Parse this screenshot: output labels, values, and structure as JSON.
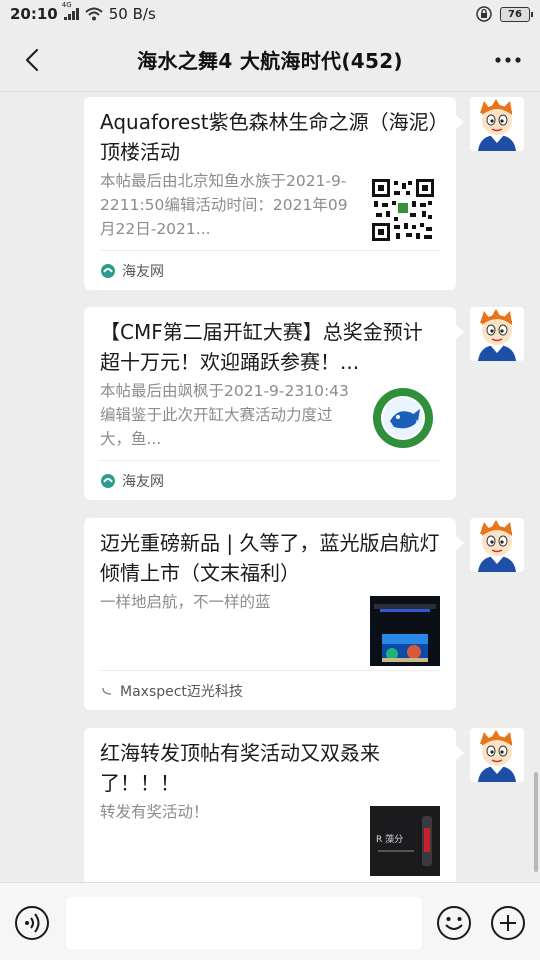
{
  "status_bar": {
    "time": "20:10",
    "network_tag": "4G",
    "speed": "50 B/s",
    "battery": "76"
  },
  "header": {
    "title": "海水之舞4 大航海时代(452)"
  },
  "messages": [
    {
      "title": "Aquaforest紫色森林生命之源（海泥）顶楼活动",
      "desc": "本帖最后由北京知鱼水族于2021-9-2211:50编辑活动时间：2021年09月22日-2021...",
      "source": "海友网",
      "thumb": "qr-code"
    },
    {
      "title": "【CMF第二届开缸大赛】总奖金预计超十万元！欢迎踊跃参赛！...",
      "desc": "本帖最后由飒枫于2021-9-2310:43编辑鉴于此次开缸大赛活动力度过大，鱼...",
      "source": "海友网",
      "thumb": "badge-logo"
    },
    {
      "title": "迈光重磅新品 | 久等了，蓝光版启航灯倾情上市（文末福利）",
      "desc": "一样地启航，不一样的蓝",
      "source": "Maxspect迈光科技",
      "thumb": "aquarium-photo"
    },
    {
      "title": "红海转发顶帖有奖活动又双叒来了！！！",
      "desc": "转发有奖活动！",
      "source": "",
      "thumb": "product-photo",
      "thumb_text": "R 藻分"
    }
  ],
  "input": {
    "value": ""
  },
  "colors": {
    "background": "#ededed",
    "card": "#ffffff",
    "source_icon": "#2a9d8f"
  }
}
